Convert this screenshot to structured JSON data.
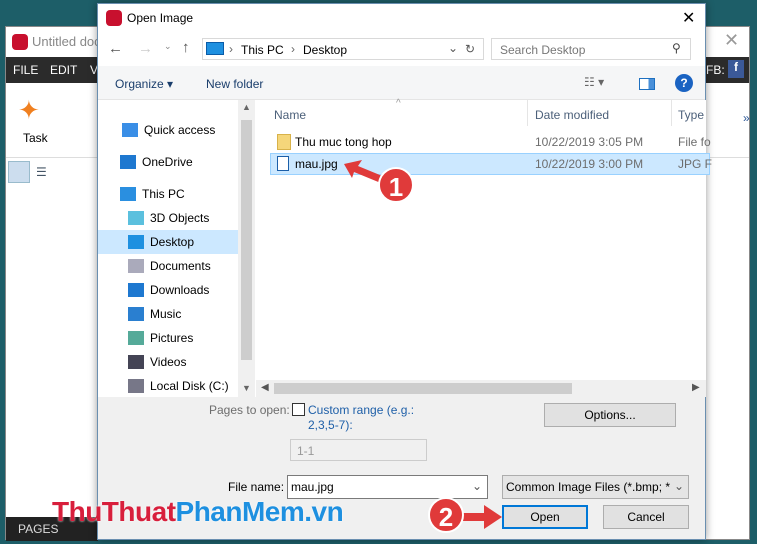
{
  "background_app": {
    "title": "Untitled doc",
    "menu": [
      "FILE",
      "EDIT",
      "V"
    ],
    "fb_label": "FB:",
    "task_label": "Task",
    "bottom_tab": "PAGES"
  },
  "dialog": {
    "title": "Open Image",
    "address": {
      "segments": [
        "This PC",
        "Desktop"
      ]
    },
    "search_placeholder": "Search Desktop",
    "toolbar": {
      "organize": "Organize",
      "new_folder": "New folder"
    },
    "nav": [
      {
        "label": "Quick access",
        "icon": "star-icon"
      },
      {
        "label": "OneDrive",
        "icon": "cloud-icon"
      },
      {
        "label": "This PC",
        "icon": "computer-icon"
      },
      {
        "label": "3D Objects",
        "icon": "cube-icon"
      },
      {
        "label": "Desktop",
        "icon": "desktop-icon",
        "selected": true
      },
      {
        "label": "Documents",
        "icon": "document-icon"
      },
      {
        "label": "Downloads",
        "icon": "download-icon"
      },
      {
        "label": "Music",
        "icon": "music-icon"
      },
      {
        "label": "Pictures",
        "icon": "picture-icon"
      },
      {
        "label": "Videos",
        "icon": "video-icon"
      },
      {
        "label": "Local Disk (C:)",
        "icon": "drive-icon"
      }
    ],
    "columns": [
      "Name",
      "Date modified",
      "Type"
    ],
    "files": [
      {
        "name": "Thu muc tong hop",
        "date": "10/22/2019 3:05 PM",
        "type": "File fo",
        "icon": "folder-icon"
      },
      {
        "name": "mau.jpg",
        "date": "10/22/2019 3:00 PM",
        "type": "JPG F",
        "icon": "image-file-icon",
        "selected": true
      }
    ],
    "pages_label": "Pages to open:",
    "custom_range_label": "Custom range (e.g.:",
    "custom_range_label2": "2,3,5-7):",
    "custom_range_checked": false,
    "range_value": "1-1",
    "options_button": "Options...",
    "file_name_label": "File name:",
    "file_name_value": "mau.jpg",
    "file_type": "Common Image Files (*.bmp; *",
    "open_button": "Open",
    "cancel_button": "Cancel"
  },
  "annotations": {
    "step1": "1",
    "step2": "2"
  },
  "watermark": {
    "part1": "ThuThuat",
    "part2": "PhanMem.vn"
  },
  "colors": {
    "selection": "#cce8ff",
    "accent": "#0078d7",
    "badge": "#e03a3a"
  }
}
